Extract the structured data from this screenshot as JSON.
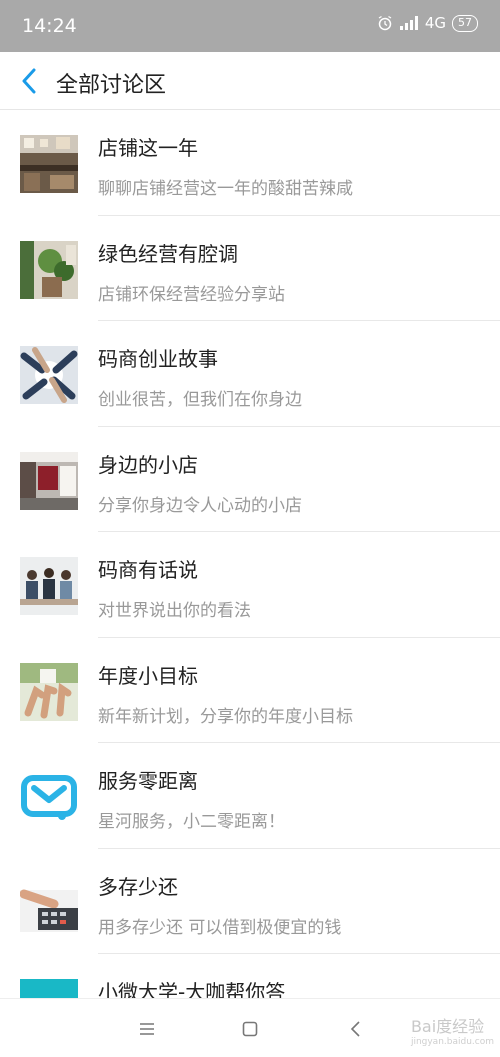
{
  "status_bar": {
    "time": "14:24",
    "network": "4G",
    "battery": "57"
  },
  "header": {
    "title": "全部讨论区"
  },
  "items": [
    {
      "title": "店铺这一年",
      "subtitle": "聊聊店铺经营这一年的酸甜苦辣咸",
      "thumb": "cafe-interior-photo"
    },
    {
      "title": "绿色经营有腔调",
      "subtitle": "店铺环保经营经验分享站",
      "thumb": "green-plants-shop-photo"
    },
    {
      "title": "码商创业故事",
      "subtitle": "创业很苦，但我们在你身边",
      "thumb": "team-hands-photo"
    },
    {
      "title": "身边的小店",
      "subtitle": "分享你身边令人心动的小店",
      "thumb": "small-shop-photo"
    },
    {
      "title": "码商有话说",
      "subtitle": "对世界说出你的看法",
      "thumb": "people-meeting-photo"
    },
    {
      "title": "年度小目标",
      "subtitle": "新年新计划，分享你的年度小目标",
      "thumb": "thumbs-up-hands-photo"
    },
    {
      "title": "服务零距离",
      "subtitle": "星河服务，小二零距离！",
      "thumb": "service-logo"
    },
    {
      "title": "多存少还",
      "subtitle": "用多存少还 可以借到极便宜的钱",
      "thumb": "calculator-hands-photo"
    },
    {
      "title": "小微大学-大咖帮你答",
      "subtitle": "",
      "thumb": "teal-banner"
    }
  ],
  "watermark": {
    "text": "Bai度经验",
    "url": "jingyan.baidu.com"
  },
  "colors": {
    "status_bar": "#a9a9a9",
    "back_arrow": "#1a9be8",
    "subtitle": "#999999",
    "service_logo": "#2bb3e6"
  }
}
